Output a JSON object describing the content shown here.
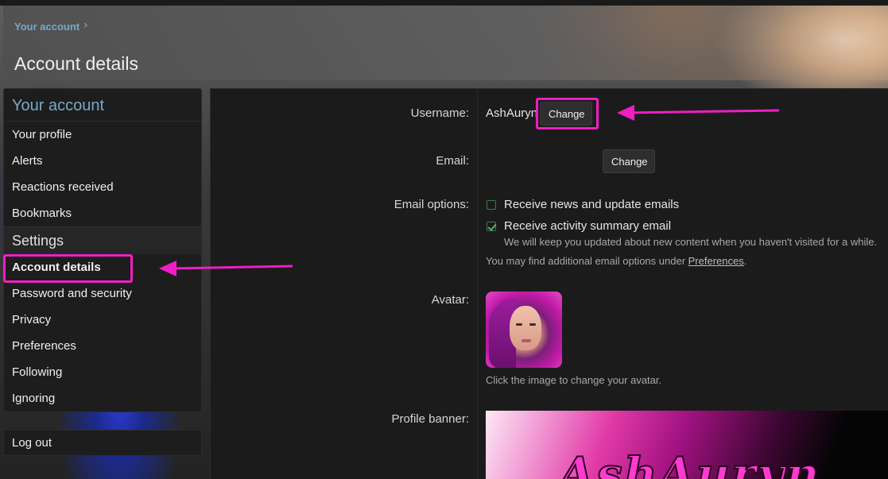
{
  "breadcrumb": {
    "label": "Your account",
    "separator": "›"
  },
  "page_title": "Account details",
  "sidebar": {
    "header": "Your account",
    "items": [
      {
        "label": "Your profile"
      },
      {
        "label": "Alerts"
      },
      {
        "label": "Reactions received"
      },
      {
        "label": "Bookmarks"
      }
    ],
    "settings_header": "Settings",
    "settings_items": [
      {
        "label": "Account details",
        "active": true
      },
      {
        "label": "Password and security"
      },
      {
        "label": "Privacy"
      },
      {
        "label": "Preferences"
      },
      {
        "label": "Following"
      },
      {
        "label": "Ignoring"
      }
    ],
    "logout": "Log out"
  },
  "form": {
    "username_label": "Username:",
    "username_value": "AshAuryn",
    "username_change": "Change",
    "email_label": "Email:",
    "email_change": "Change",
    "email_options_label": "Email options:",
    "opt_news": "Receive news and update emails",
    "opt_news_checked": false,
    "opt_activity": "Receive activity summary email",
    "opt_activity_checked": true,
    "opt_activity_hint": "We will keep you updated about new content when you haven't visited for a while.",
    "more_options_prefix": "You may find additional email options under ",
    "more_options_link": "Preferences",
    "more_options_suffix": ".",
    "avatar_label": "Avatar:",
    "avatar_hint": "Click the image to change your avatar.",
    "banner_label": "Profile banner:",
    "banner_text": "AshAuryn"
  },
  "colors": {
    "accent": "#79a8c8",
    "highlight": "#ee1fc2",
    "check": "#58b36a"
  }
}
